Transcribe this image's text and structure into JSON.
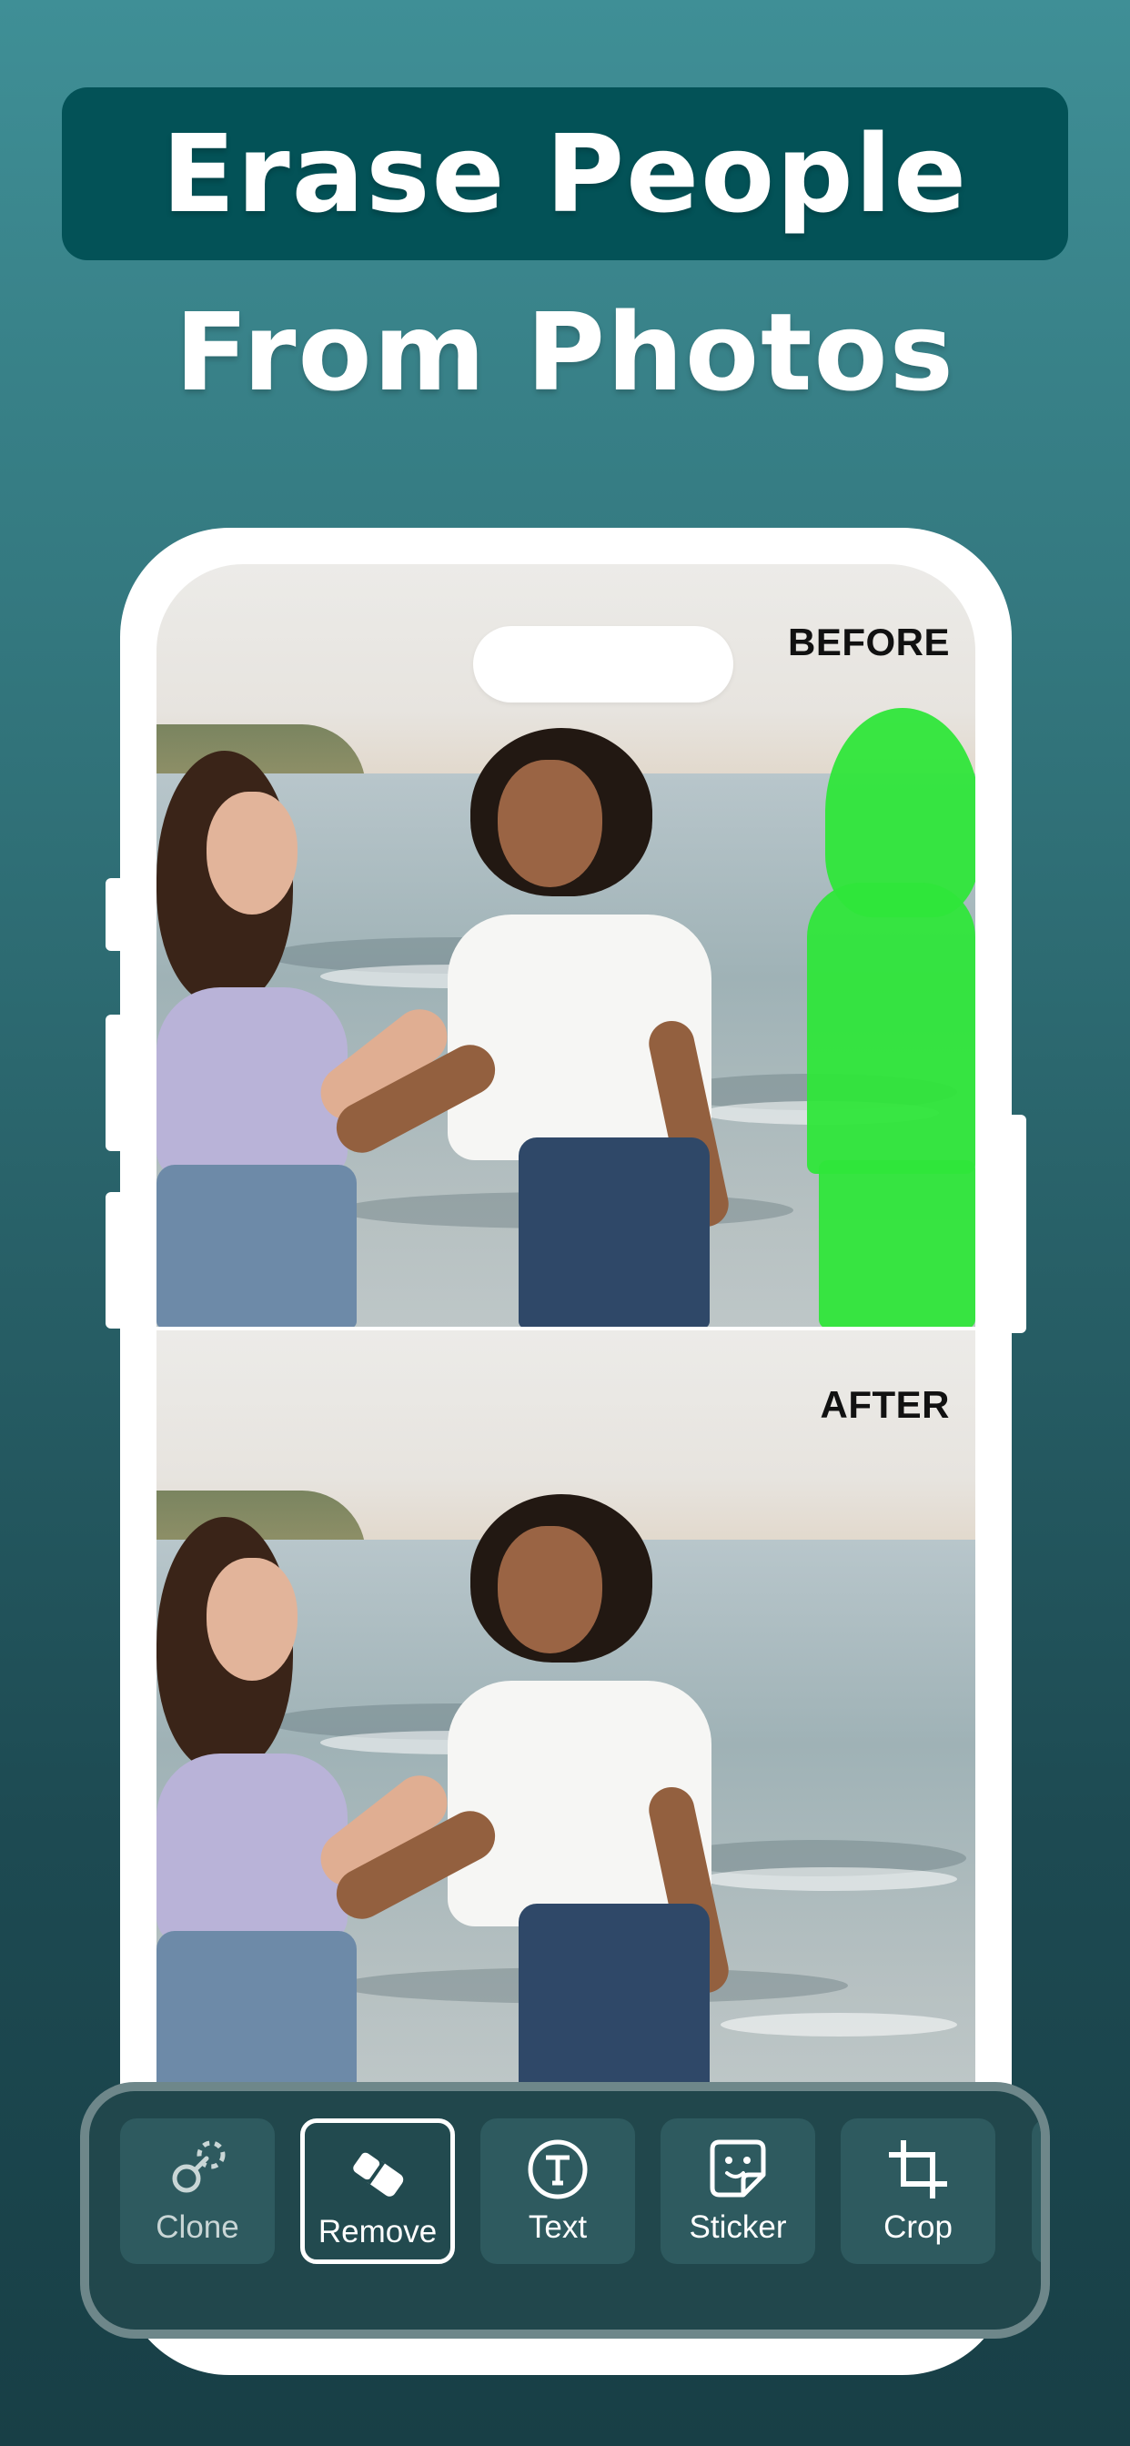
{
  "headline": {
    "line1": "Erase People",
    "line2": "From Photos"
  },
  "panels": {
    "before_label": "BEFORE",
    "after_label": "AFTER"
  },
  "toolbar": {
    "items": [
      {
        "label": "Clone",
        "icon": "clone-icon"
      },
      {
        "label": "Remove",
        "icon": "eraser-icon",
        "selected": true
      },
      {
        "label": "Text",
        "icon": "text-circle-icon"
      },
      {
        "label": "Sticker",
        "icon": "sticker-icon"
      },
      {
        "label": "Crop",
        "icon": "crop-icon"
      }
    ]
  },
  "colors": {
    "background_top": "#3f8f96",
    "background_bottom": "#183f46",
    "headline_pill": "#035257",
    "selection_mask": "#2fe63a",
    "toolbar": "#21474c"
  }
}
